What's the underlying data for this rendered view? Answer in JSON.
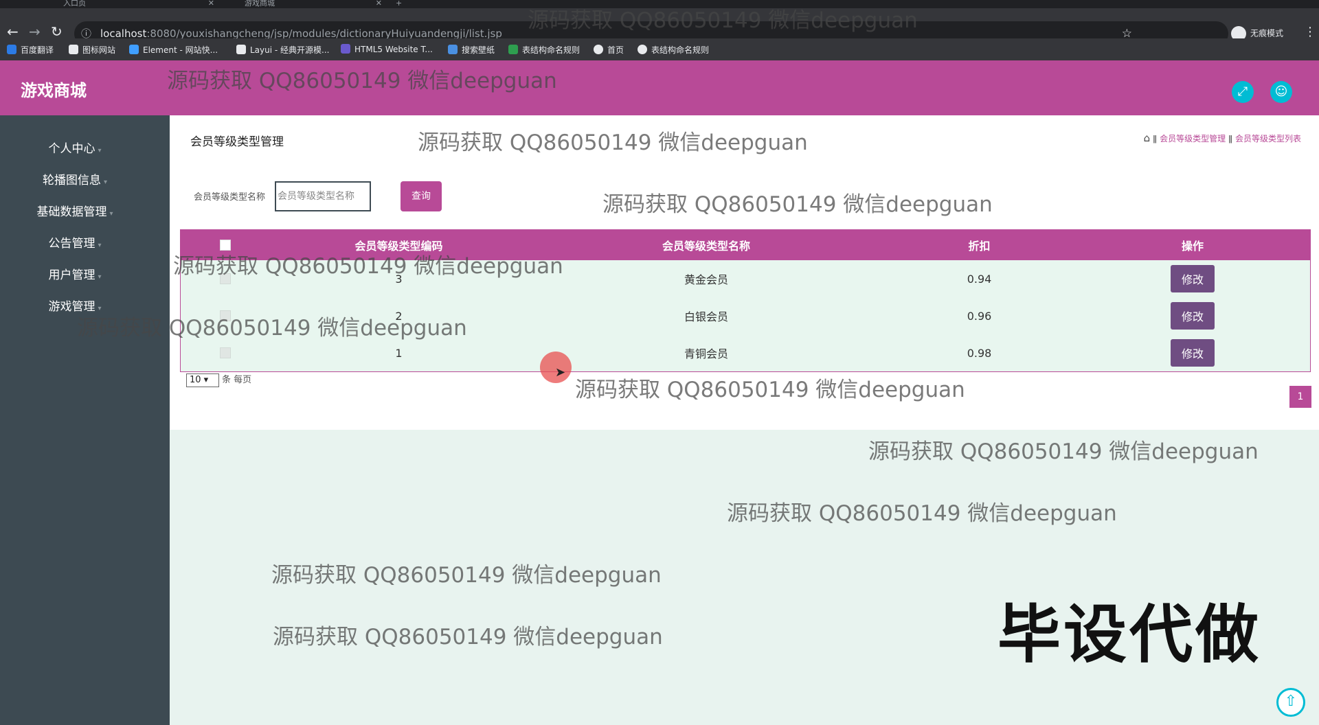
{
  "browser": {
    "tabs": [
      {
        "label": "入口页"
      },
      {
        "label": "游戏商城"
      }
    ],
    "new_tab": "+",
    "url_host": "localhost",
    "url_path": ":8080/youxishangcheng/jsp/modules/dictionaryHuiyuandengji/list.jsp",
    "incognito_label": "无痕模式",
    "bookmarks": [
      {
        "label": "百度翻译",
        "color": "#2c7be5"
      },
      {
        "label": "图标网站",
        "color": "#e8eaed"
      },
      {
        "label": "Element - 网站快...",
        "color": "#409eff"
      },
      {
        "label": "Layui - 经典开源模...",
        "color": "#e8eaed"
      },
      {
        "label": "HTML5 Website T...",
        "color": "#6a5acd"
      },
      {
        "label": "搜索壁纸",
        "color": "#4a90e2"
      },
      {
        "label": "表结构命名规则",
        "color": "#2e9e4f"
      },
      {
        "label": "首页",
        "color": "#e8eaed"
      },
      {
        "label": "表结构命名规则",
        "color": "#e8eaed"
      }
    ]
  },
  "app": {
    "brand": "游戏商城",
    "accent": "#b84a97",
    "header_icons": [
      "fullscreen-icon",
      "user-icon"
    ]
  },
  "sidebar": {
    "items": [
      {
        "label": "个人中心"
      },
      {
        "label": "轮播图信息"
      },
      {
        "label": "基础数据管理"
      },
      {
        "label": "公告管理"
      },
      {
        "label": "用户管理"
      },
      {
        "label": "游戏管理"
      }
    ]
  },
  "main": {
    "title": "会员等级类型管理",
    "breadcrumb": [
      "会员等级类型管理",
      "会员等级类型列表"
    ],
    "search_label": "会员等级类型名称",
    "search_placeholder": "会员等级类型名称",
    "search_button": "查询",
    "table": {
      "headers": [
        "会员等级类型编码",
        "会员等级类型名称",
        "折扣",
        "操作"
      ],
      "rows": [
        {
          "code": "3",
          "name": "黄金会员",
          "discount": "0.94",
          "action": "修改"
        },
        {
          "code": "2",
          "name": "白银会员",
          "discount": "0.96",
          "action": "修改"
        },
        {
          "code": "1",
          "name": "青铜会员",
          "discount": "0.98",
          "action": "修改"
        }
      ]
    },
    "page_size": "10",
    "page_size_suffix": "条 每页",
    "current_page": "1"
  },
  "watermark": "源码获取 QQ86050149 微信deepguan",
  "big_mark": "毕设代做"
}
